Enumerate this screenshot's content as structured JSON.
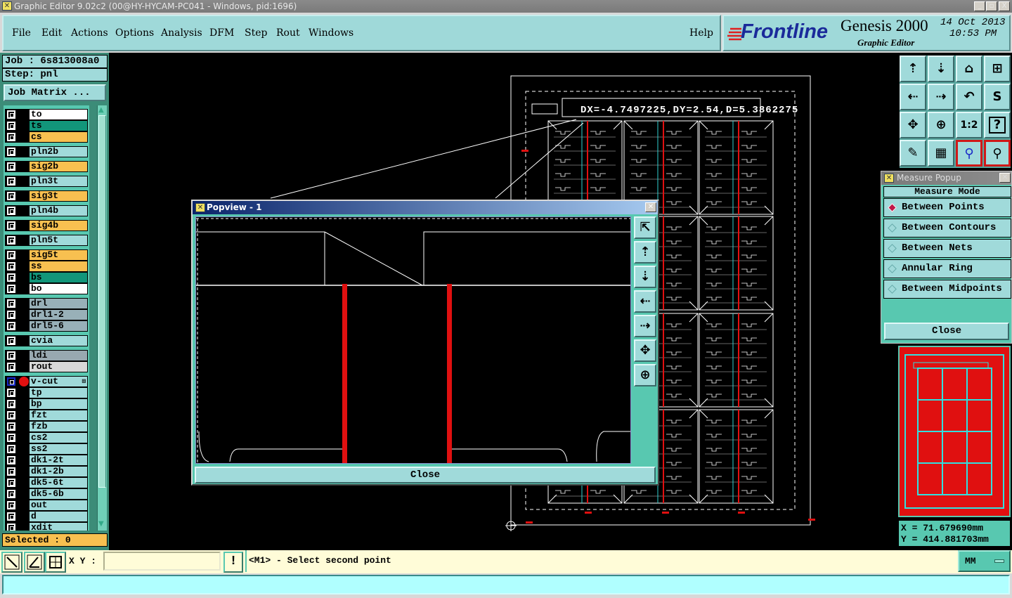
{
  "window": {
    "title": "Graphic Editor 9.02c2 (00@HY-HYCAM-PC041 - Windows, pid:1696)",
    "controls": [
      "_",
      "▫",
      "X"
    ]
  },
  "menu": {
    "items": [
      "File",
      "Edit",
      "Actions",
      "Options",
      "Analysis",
      "DFM",
      "Step",
      "Rout",
      "Windows"
    ],
    "help": "Help"
  },
  "logo": {
    "brand": "Frontline",
    "product": "Genesis 2000",
    "subtitle": "Graphic Editor",
    "date": "14 Oct 2013",
    "time": "10:53 PM"
  },
  "job": {
    "job_line": "Job : 6s813008a0",
    "step_line": "Step: pnl",
    "matrix_button": "Job Matrix ..."
  },
  "colors": {
    "white": "#ffffff",
    "teal": "#12967a",
    "orange": "#f8c050",
    "cyan": "#a0dada",
    "drill": "#98b0b8",
    "gray": "#98a8b0",
    "light": "#d8d8d8",
    "accent_red": "#e01010"
  },
  "layers": [
    {
      "name": "to",
      "color": "white",
      "group": 0
    },
    {
      "name": "ts",
      "color": "teal",
      "group": 0
    },
    {
      "name": "cs",
      "color": "orange",
      "group": 0
    },
    {
      "name": "pln2b",
      "color": "cyan",
      "group": 1
    },
    {
      "name": "sig2b",
      "color": "orange",
      "group": 2
    },
    {
      "name": "pln3t",
      "color": "cyan",
      "group": 3
    },
    {
      "name": "sig3t",
      "color": "orange",
      "group": 4
    },
    {
      "name": "pln4b",
      "color": "cyan",
      "group": 5
    },
    {
      "name": "sig4b",
      "color": "orange",
      "group": 6
    },
    {
      "name": "pln5t",
      "color": "cyan",
      "group": 7
    },
    {
      "name": "sig5t",
      "color": "orange",
      "group": 8
    },
    {
      "name": "ss",
      "color": "orange",
      "group": 8
    },
    {
      "name": "bs",
      "color": "teal",
      "group": 8
    },
    {
      "name": "bo",
      "color": "white",
      "group": 8
    },
    {
      "name": "drl",
      "color": "drill",
      "group": 9
    },
    {
      "name": "drl1-2",
      "color": "drill",
      "group": 9
    },
    {
      "name": "drl5-6",
      "color": "drill",
      "group": 9
    },
    {
      "name": "cvia",
      "color": "cyan",
      "group": 10
    },
    {
      "name": "ldi",
      "color": "gray",
      "group": 11
    },
    {
      "name": "rout",
      "color": "light",
      "group": 11
    },
    {
      "name": "v-cut",
      "color": "cyan",
      "group": 12,
      "work": true
    },
    {
      "name": "tp",
      "color": "cyan",
      "group": 12
    },
    {
      "name": "bp",
      "color": "cyan",
      "group": 12
    },
    {
      "name": "fzt",
      "color": "cyan",
      "group": 12
    },
    {
      "name": "fzb",
      "color": "cyan",
      "group": 12
    },
    {
      "name": "cs2",
      "color": "cyan",
      "group": 12
    },
    {
      "name": "ss2",
      "color": "cyan",
      "group": 12
    },
    {
      "name": "dk1-2t",
      "color": "cyan",
      "group": 12
    },
    {
      "name": "dk1-2b",
      "color": "cyan",
      "group": 12
    },
    {
      "name": "dk5-6t",
      "color": "cyan",
      "group": 12
    },
    {
      "name": "dk5-6b",
      "color": "cyan",
      "group": 12
    },
    {
      "name": "out",
      "color": "cyan",
      "group": 12
    },
    {
      "name": "d",
      "color": "cyan",
      "group": 12
    },
    {
      "name": "xdit",
      "color": "cyan",
      "group": 12
    }
  ],
  "selected": "Selected : 0",
  "measure_readout": "DX=-4.7497225,DY=2.54,D=5.3862275",
  "toolbar_icons": [
    "pan-up-icon",
    "pan-down-icon",
    "home-icon",
    "xy-grid-icon",
    "pan-left-icon",
    "pan-right-icon",
    "undo-zoom-icon",
    "snap-icon",
    "zoom-fit-icon",
    "zoom-center-icon",
    "zoom-ratio-icon",
    "help-query-icon",
    "tools-palette-icon",
    "window-layout-icon",
    "net-highlight-icon",
    "net-measure-icon"
  ],
  "toolbar_ratio_label": "1:2",
  "toolbar_help_label": "?",
  "measure_popup": {
    "title": "Measure Popup",
    "heading": "Measure Mode",
    "options": [
      "Between Points",
      "Between Contours",
      "Between Nets",
      "Annular Ring",
      "Between Midpoints"
    ],
    "selected_index": 0,
    "close": "Close"
  },
  "coordinates": {
    "x": "X  =  71.679690mm",
    "y": "Y  =  414.881703mm"
  },
  "bottom": {
    "xy_label": "X Y :",
    "xy_value": "",
    "message": "<M1> - Select second point",
    "units": "MM",
    "bang": "!"
  },
  "popview": {
    "title": "Popview - 1",
    "close": "Close",
    "icons": [
      "fit-window-icon",
      "pan-up-icon",
      "pan-down-icon",
      "pan-left-icon",
      "pan-right-icon",
      "zoom-out-icon",
      "zoom-in-icon"
    ]
  }
}
